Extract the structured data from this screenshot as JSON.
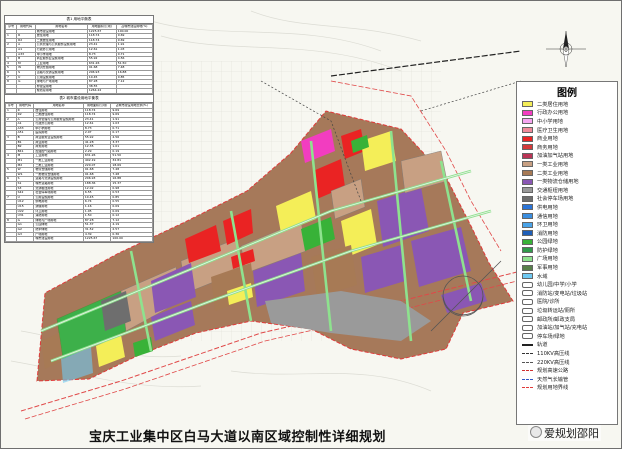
{
  "map_title": "宝庆工业集中区白马大道以南区域控制性详细规划",
  "watermark": "爱规划邵阳",
  "legend": {
    "title": "图例",
    "items": [
      {
        "label": "二类居住用地",
        "color": "#f4ee58",
        "kind": "fill"
      },
      {
        "label": "行政办公用地",
        "color": "#f23dc0",
        "kind": "fill"
      },
      {
        "label": "中小学用地",
        "color": "#f6a5f0",
        "kind": "fill"
      },
      {
        "label": "医疗卫生用地",
        "color": "#f08a9a",
        "kind": "fill"
      },
      {
        "label": "商业用地",
        "color": "#ea2323",
        "kind": "fill"
      },
      {
        "label": "商务用地",
        "color": "#d43a3a",
        "kind": "fill"
      },
      {
        "label": "加油加气站用地",
        "color": "#ba3456",
        "kind": "fill"
      },
      {
        "label": "一类工业用地",
        "color": "#c8a083",
        "kind": "fill"
      },
      {
        "label": "二类工业用地",
        "color": "#a77a55",
        "kind": "fill"
      },
      {
        "label": "一类物流仓储用地",
        "color": "#8a57b4",
        "kind": "fill"
      },
      {
        "label": "交通枢纽用地",
        "color": "#9a9a9a",
        "kind": "fill"
      },
      {
        "label": "社会停车场用地",
        "color": "#6e6e6e",
        "kind": "fill"
      },
      {
        "label": "供电用地",
        "color": "#2b74d8",
        "kind": "fill"
      },
      {
        "label": "通信用地",
        "color": "#3b8ee0",
        "kind": "fill"
      },
      {
        "label": "环卫用地",
        "color": "#4aa3e8",
        "kind": "fill"
      },
      {
        "label": "消防用地",
        "color": "#1f5fb8",
        "kind": "fill"
      },
      {
        "label": "公园绿地",
        "color": "#38b238",
        "kind": "fill"
      },
      {
        "label": "防护绿地",
        "color": "#2f9a4a",
        "kind": "fill"
      },
      {
        "label": "广场用地",
        "color": "#8ee28e",
        "kind": "fill"
      },
      {
        "label": "军事用地",
        "color": "#58804a",
        "kind": "fill"
      },
      {
        "label": "水域",
        "color": "#6fc9f2",
        "kind": "fill"
      },
      {
        "label": "幼儿园/中学/小学",
        "color": "#ffffff",
        "kind": "symbol"
      },
      {
        "label": "消防站/变电站/垃圾站",
        "color": "#ffffff",
        "kind": "symbol"
      },
      {
        "label": "医院/诊所",
        "color": "#ffffff",
        "kind": "symbol"
      },
      {
        "label": "垃圾转运站/厕所",
        "color": "#ffffff",
        "kind": "symbol"
      },
      {
        "label": "邮政所/邮政支局",
        "color": "#ffffff",
        "kind": "symbol"
      },
      {
        "label": "加油站/加气站/充电站",
        "color": "#ffffff",
        "kind": "symbol"
      },
      {
        "label": "停车场/绿地",
        "color": "#ffffff",
        "kind": "symbol"
      },
      {
        "label": "轨道",
        "color": "#222222",
        "kind": "line"
      },
      {
        "label": "110KV高压线",
        "color": "#333333",
        "kind": "dash"
      },
      {
        "label": "220KV高压线",
        "color": "#555555",
        "kind": "dash"
      },
      {
        "label": "规划高速公路",
        "color": "#d13030",
        "kind": "dash"
      },
      {
        "label": "天然气长输管",
        "color": "#3058c8",
        "kind": "dash"
      },
      {
        "label": "规划用地界线",
        "color": "#e13a3a",
        "kind": "dash"
      }
    ]
  },
  "table1": {
    "title": "表1 用地平衡表",
    "headers": [
      "序号",
      "用地代码",
      "用地名称",
      "用地面积(公顷)",
      "占城市建设用地(%)"
    ],
    "rows": [
      [
        "",
        "",
        "城市建设用地",
        "1225.67",
        "100.00"
      ],
      [
        "1",
        "R",
        "居住用地",
        "118.74",
        "9.69"
      ],
      [
        "",
        "R2",
        "二类居住用地",
        "118.74",
        "9.69"
      ],
      [
        "2",
        "A",
        "公共管理与公共服务设施用地",
        "23.41",
        "1.91"
      ],
      [
        "",
        "A1",
        "行政办公用地",
        "12.61",
        "1.03"
      ],
      [
        "",
        "A33",
        "中小学用地",
        "8.73",
        "0.71"
      ],
      [
        "3",
        "B",
        "商业服务业设施用地",
        "55.92",
        "4.56"
      ],
      [
        "4",
        "M",
        "工业用地",
        "631.26",
        "51.50"
      ],
      [
        "5",
        "W",
        "物流仓储用地",
        "91.68",
        "7.48"
      ],
      [
        "6",
        "S",
        "道路与交通设施用地",
        "206.93",
        "16.88"
      ],
      [
        "7",
        "U",
        "公用设施用地",
        "10.45",
        "0.85"
      ],
      [
        "8",
        "G",
        "绿地与广场用地",
        "87.28",
        "7.12"
      ],
      [
        "",
        "",
        "非建设用地",
        "38.55",
        ""
      ],
      [
        "",
        "",
        "规划总用地",
        "1264.22",
        ""
      ]
    ]
  },
  "table2": {
    "title": "表2 城市建设用地平衡表",
    "headers": [
      "序号",
      "用地代码",
      "用地名称",
      "用地面积(公顷)",
      "占城市建设用地比例(%)"
    ],
    "rows": [
      [
        "1",
        "R",
        "居住用地",
        "118.74",
        "9.69"
      ],
      [
        "",
        "R2",
        "二类居住用地",
        "118.74",
        "9.69"
      ],
      [
        "2",
        "A",
        "公共管理与公共服务设施用地",
        "23.41",
        "1.91"
      ],
      [
        "",
        "A1",
        "行政办公用地",
        "12.61",
        "1.03"
      ],
      [
        "",
        "A33",
        "中小学用地",
        "8.73",
        "0.71"
      ],
      [
        "",
        "A51",
        "医院用地",
        "2.07",
        "0.17"
      ],
      [
        "3",
        "B",
        "商业服务业设施用地",
        "55.92",
        "4.56"
      ],
      [
        "",
        "B1",
        "商业用地",
        "41.28",
        "3.37"
      ],
      [
        "",
        "B2",
        "商务用地",
        "12.35",
        "1.01"
      ],
      [
        "",
        "B41",
        "加油加气站用地",
        "2.29",
        "0.19"
      ],
      [
        "4",
        "M",
        "工业用地",
        "631.26",
        "51.50"
      ],
      [
        "",
        "M1",
        "一类工业用地",
        "402.19",
        "32.81"
      ],
      [
        "",
        "M2",
        "二类工业用地",
        "229.07",
        "18.69"
      ],
      [
        "5",
        "W",
        "物流仓储用地",
        "91.68",
        "7.48"
      ],
      [
        "",
        "W1",
        "一类物流仓储用地",
        "91.68",
        "7.48"
      ],
      [
        "6",
        "S",
        "道路与交通设施用地",
        "206.93",
        "16.88"
      ],
      [
        "",
        "S1",
        "城市道路用地",
        "188.36",
        "15.37"
      ],
      [
        "",
        "S3",
        "交通枢纽用地",
        "12.02",
        "0.98"
      ],
      [
        "",
        "S42",
        "社会停车场用地",
        "6.55",
        "0.53"
      ],
      [
        "7",
        "U",
        "公用设施用地",
        "10.45",
        "0.85"
      ],
      [
        "",
        "U12",
        "供电用地",
        "6.74",
        "0.55"
      ],
      [
        "",
        "U15",
        "通信用地",
        "1.16",
        "0.09"
      ],
      [
        "",
        "U22",
        "环卫用地",
        "1.05",
        "0.09"
      ],
      [
        "",
        "U31",
        "消防用地",
        "1.50",
        "0.12"
      ],
      [
        "8",
        "G",
        "绿地与广场用地",
        "87.28",
        "7.12"
      ],
      [
        "",
        "G1",
        "公园绿地",
        "51.37",
        "4.19"
      ],
      [
        "",
        "G2",
        "防护绿地",
        "31.52",
        "2.57"
      ],
      [
        "",
        "G3",
        "广场用地",
        "4.39",
        "0.36"
      ],
      [
        "",
        "",
        "城市建设用地",
        "1225.67",
        "100.00"
      ]
    ]
  }
}
